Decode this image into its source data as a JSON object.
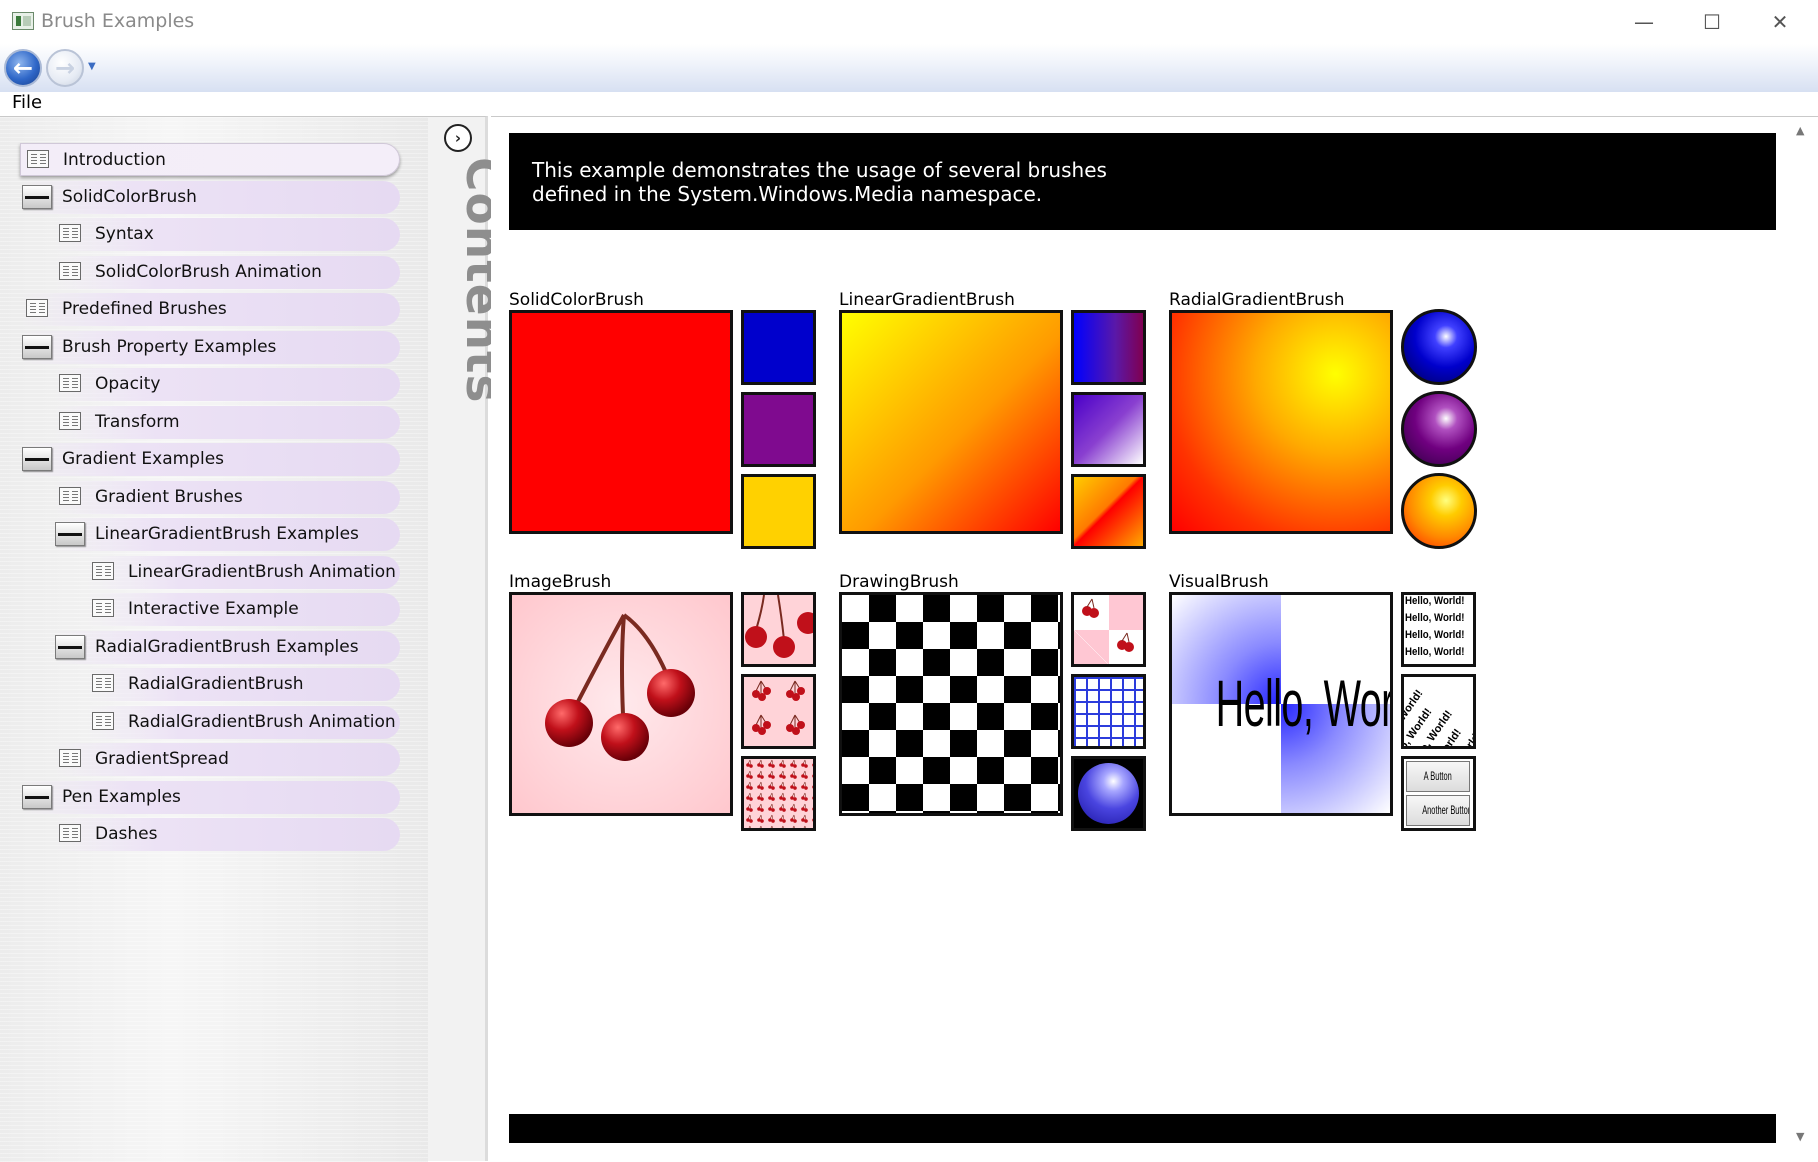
{
  "window": {
    "title": "Brush Examples",
    "minimize_glyph": "—",
    "maximize_glyph": "☐",
    "close_glyph": "✕"
  },
  "nav": {
    "back_glyph": "←",
    "forward_glyph": "→",
    "dropdown_glyph": "▼"
  },
  "menu": {
    "file": "File"
  },
  "tree": [
    {
      "label": "Introduction",
      "icon": "page-icon",
      "level": 0,
      "selected": true
    },
    {
      "label": "SolidColorBrush",
      "icon": "book-icon",
      "level": 0
    },
    {
      "label": "Syntax",
      "icon": "page-icon",
      "level": 1
    },
    {
      "label": "SolidColorBrush Animation",
      "icon": "page-icon",
      "level": 1
    },
    {
      "label": "Predefined Brushes",
      "icon": "page-icon",
      "level": 0
    },
    {
      "label": "Brush Property Examples",
      "icon": "book-icon",
      "level": 0
    },
    {
      "label": "Opacity",
      "icon": "page-icon",
      "level": 1
    },
    {
      "label": "Transform",
      "icon": "page-icon",
      "level": 1
    },
    {
      "label": "Gradient Examples",
      "icon": "book-icon",
      "level": 0
    },
    {
      "label": "Gradient Brushes",
      "icon": "page-icon",
      "level": 1
    },
    {
      "label": "LinearGradientBrush Examples",
      "icon": "book-icon",
      "level": 1
    },
    {
      "label": "LinearGradientBrush Animation",
      "icon": "page-icon",
      "level": 2
    },
    {
      "label": "Interactive Example",
      "icon": "page-icon",
      "level": 2
    },
    {
      "label": "RadialGradientBrush Examples",
      "icon": "book-icon",
      "level": 1
    },
    {
      "label": "RadialGradientBrush",
      "icon": "page-icon",
      "level": 2
    },
    {
      "label": "RadialGradientBrush Animation",
      "icon": "page-icon",
      "level": 2
    },
    {
      "label": "GradientSpread",
      "icon": "page-icon",
      "level": 1
    },
    {
      "label": "Pen Examples",
      "icon": "book-icon",
      "level": 0
    },
    {
      "label": "Dashes",
      "icon": "page-icon",
      "level": 1
    }
  ],
  "contents": {
    "label": "Contents",
    "toggle_glyph": "›"
  },
  "header": {
    "line1": "This example demonstrates the usage of several brushes",
    "line2": "defined in the System.Windows.Media namespace."
  },
  "sections": {
    "solid": "SolidColorBrush",
    "linear": "LinearGradientBrush",
    "radial": "RadialGradientBrush",
    "image": "ImageBrush",
    "drawing": "DrawingBrush",
    "visual": "VisualBrush"
  },
  "visual_brush": {
    "big_text": "Hello, World!",
    "tile_text": "Hello, World!",
    "button_1": "A Button",
    "button_2": "Another Button"
  },
  "colors": {
    "solid_red": "#ff0000",
    "solid_blue": "#0000cc",
    "solid_purple": "#7f0a8f",
    "solid_gold": "#ffd100",
    "cherry_red": "#c0101a",
    "cherry_bg": "#ffd3d8"
  },
  "scroll": {
    "up_glyph": "▲",
    "down_glyph": "▼"
  }
}
